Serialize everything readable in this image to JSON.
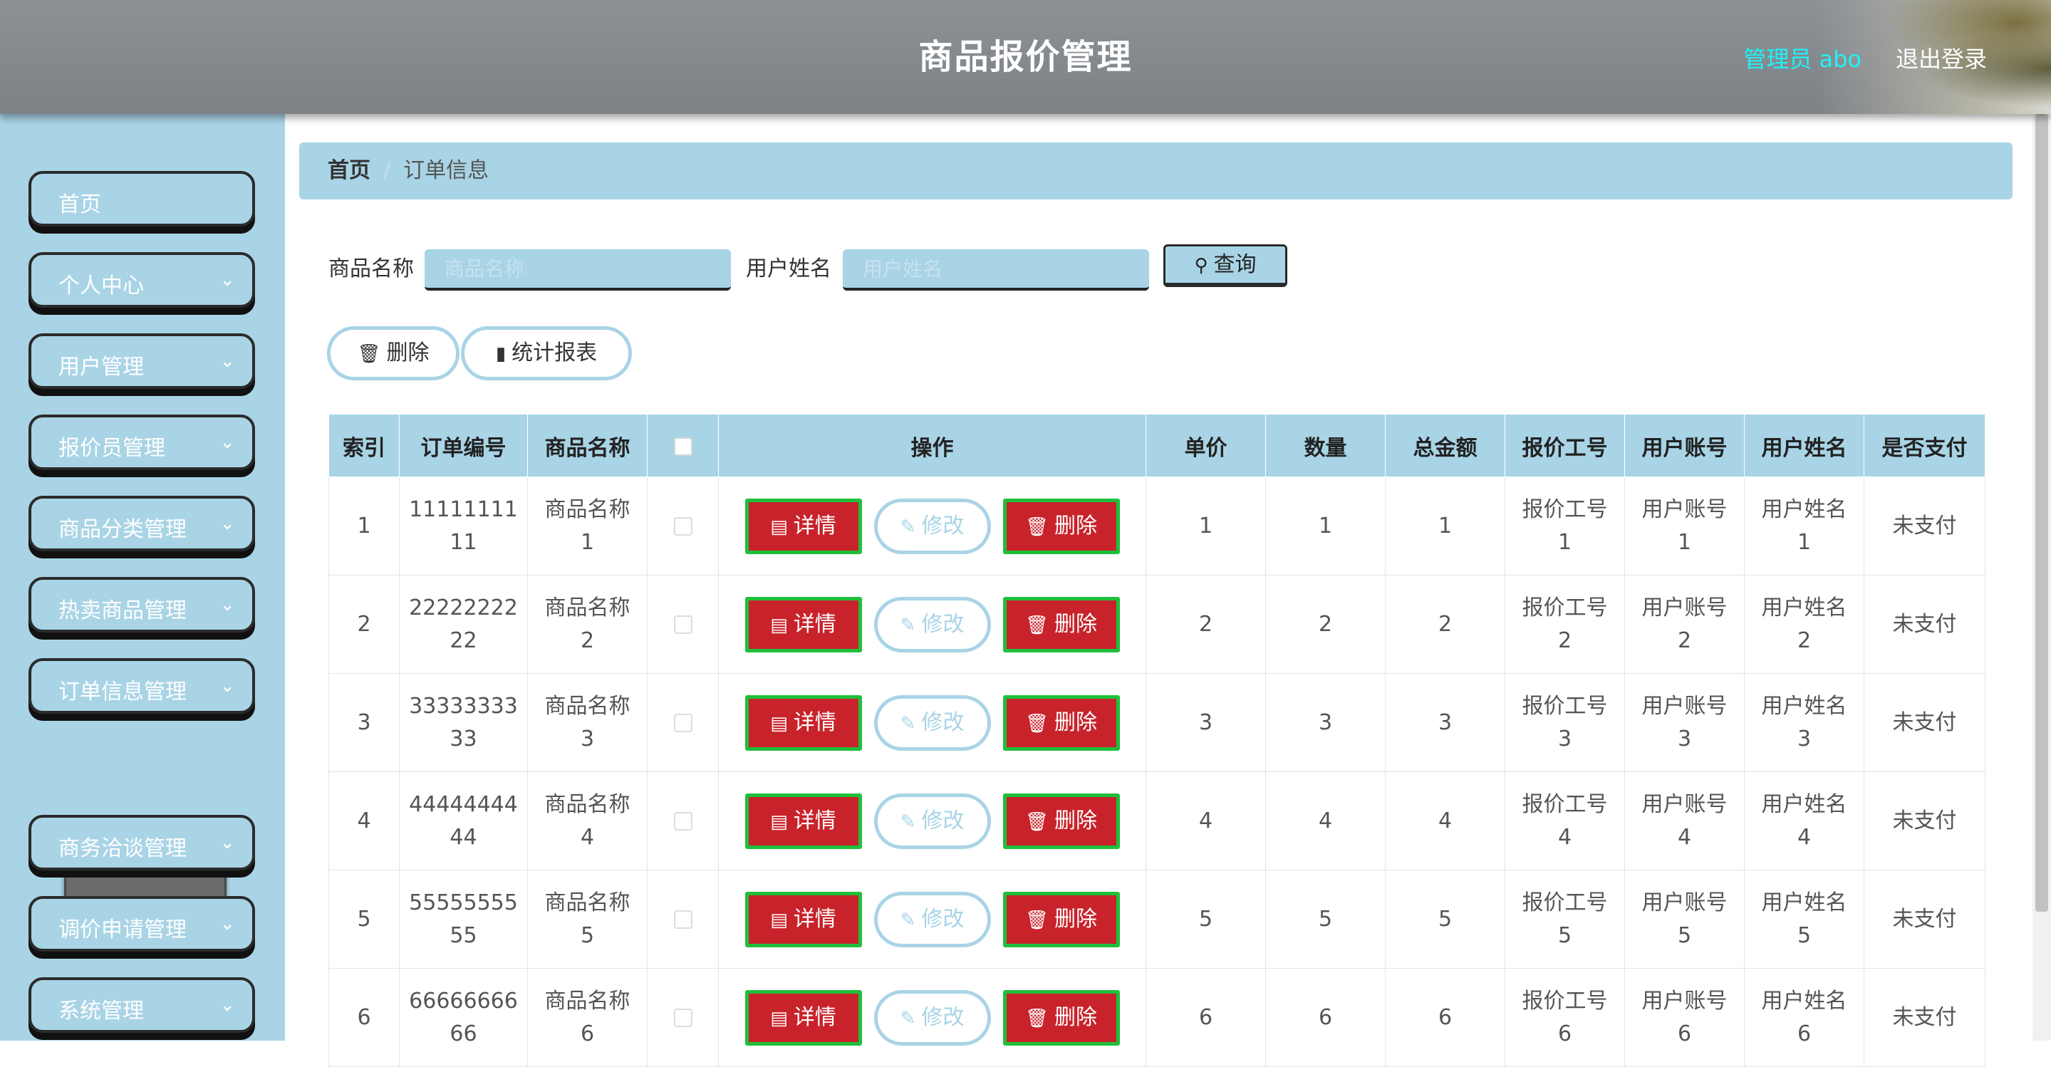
{
  "header": {
    "title": "商品报价管理",
    "admin_label": "管理员 abo",
    "logout_label": "退出登录"
  },
  "sidebar": {
    "items": [
      {
        "label": "首页",
        "expandable": false
      },
      {
        "label": "个人中心",
        "expandable": true
      },
      {
        "label": "用户管理",
        "expandable": true
      },
      {
        "label": "报价员管理",
        "expandable": true
      },
      {
        "label": "商品分类管理",
        "expandable": true
      },
      {
        "label": "热卖商品管理",
        "expandable": true
      },
      {
        "label": "订单信息管理",
        "expandable": true
      },
      {
        "label": "商务洽谈管理",
        "expandable": true
      },
      {
        "label": "调价申请管理",
        "expandable": true
      },
      {
        "label": "系统管理",
        "expandable": true
      }
    ],
    "active_sub_item": "订单信息"
  },
  "breadcrumb": {
    "home": "首页",
    "separator": "/",
    "current": "订单信息"
  },
  "search": {
    "product_label": "商品名称",
    "product_placeholder": "商品名称",
    "product_value": "",
    "user_label": "用户姓名",
    "user_placeholder": "用户姓名",
    "user_value": "",
    "query_label": "查询"
  },
  "actions": {
    "delete_label": "删除",
    "report_label": "统计报表"
  },
  "table": {
    "headers": {
      "index": "索引",
      "order_no": "订单编号",
      "product": "商品名称",
      "ops": "操作",
      "price": "单价",
      "qty": "数量",
      "total": "总金额",
      "quote_id": "报价工号",
      "account": "用户账号",
      "username": "用户姓名",
      "paid": "是否支付"
    },
    "buttons": {
      "detail": "详情",
      "edit": "修改",
      "delete": "删除"
    },
    "rows": [
      {
        "index": "1",
        "order_no_a": "11111111",
        "order_no_b": "11",
        "product_a": "商品名称",
        "product_b": "1",
        "price": "1",
        "qty": "1",
        "total": "1",
        "quote_a": "报价工号",
        "quote_b": "1",
        "account_a": "用户账号",
        "account_b": "1",
        "username_a": "用户姓名",
        "username_b": "1",
        "paid": "未支付"
      },
      {
        "index": "2",
        "order_no_a": "22222222",
        "order_no_b": "22",
        "product_a": "商品名称",
        "product_b": "2",
        "price": "2",
        "qty": "2",
        "total": "2",
        "quote_a": "报价工号",
        "quote_b": "2",
        "account_a": "用户账号",
        "account_b": "2",
        "username_a": "用户姓名",
        "username_b": "2",
        "paid": "未支付"
      },
      {
        "index": "3",
        "order_no_a": "33333333",
        "order_no_b": "33",
        "product_a": "商品名称",
        "product_b": "3",
        "price": "3",
        "qty": "3",
        "total": "3",
        "quote_a": "报价工号",
        "quote_b": "3",
        "account_a": "用户账号",
        "account_b": "3",
        "username_a": "用户姓名",
        "username_b": "3",
        "paid": "未支付"
      },
      {
        "index": "4",
        "order_no_a": "44444444",
        "order_no_b": "44",
        "product_a": "商品名称",
        "product_b": "4",
        "price": "4",
        "qty": "4",
        "total": "4",
        "quote_a": "报价工号",
        "quote_b": "4",
        "account_a": "用户账号",
        "account_b": "4",
        "username_a": "用户姓名",
        "username_b": "4",
        "paid": "未支付"
      },
      {
        "index": "5",
        "order_no_a": "55555555",
        "order_no_b": "55",
        "product_a": "商品名称",
        "product_b": "5",
        "price": "5",
        "qty": "5",
        "total": "5",
        "quote_a": "报价工号",
        "quote_b": "5",
        "account_a": "用户账号",
        "account_b": "5",
        "username_a": "用户姓名",
        "username_b": "5",
        "paid": "未支付"
      },
      {
        "index": "6",
        "order_no_a": "66666666",
        "order_no_b": "66",
        "product_a": "商品名称",
        "product_b": "6",
        "price": "6",
        "qty": "6",
        "total": "6",
        "quote_a": "报价工号",
        "quote_b": "6",
        "account_a": "用户账号",
        "account_b": "6",
        "username_a": "用户姓名",
        "username_b": "6",
        "paid": "未支付"
      }
    ]
  },
  "colors": {
    "accent": "#a9d4e6",
    "header_bg": "#878c91",
    "admin_text": "#1ff3f7",
    "danger": "#c8232b",
    "danger_border": "#1fbf3b"
  }
}
